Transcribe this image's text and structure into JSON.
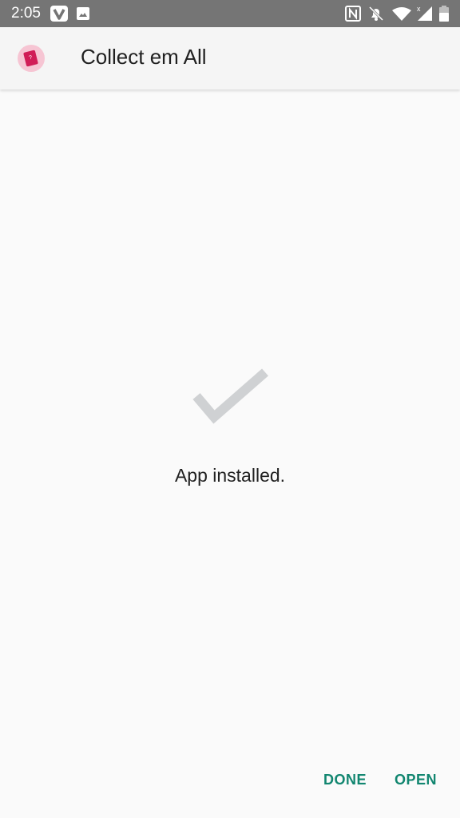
{
  "status_bar": {
    "time": "2:05",
    "left_icons": [
      "vivaldi-icon",
      "image-icon"
    ],
    "right_icons": [
      "nfc-icon",
      "notifications-off-icon",
      "wifi-icon",
      "cellular-signal-icon",
      "battery-icon"
    ]
  },
  "app_bar": {
    "app_icon": "collect-em-all-app-icon",
    "title": "Collect em All"
  },
  "main": {
    "status_icon": "checkmark-icon",
    "message": "App installed."
  },
  "actions": {
    "done_label": "DONE",
    "open_label": "OPEN"
  },
  "colors": {
    "accent": "#128670",
    "status_bar": "#757575",
    "checkmark": "#cfd1d3"
  }
}
